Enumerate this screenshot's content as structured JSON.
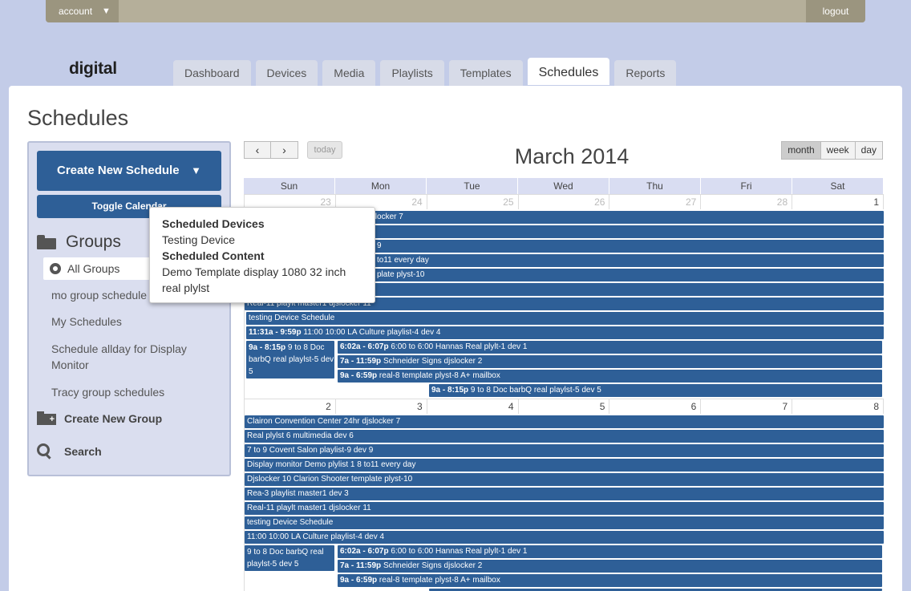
{
  "topbar": {
    "account_label": "account",
    "logout_label": "logout"
  },
  "logo": "digital",
  "tabs": [
    "Dashboard",
    "Devices",
    "Media",
    "Playlists",
    "Templates",
    "Schedules",
    "Reports"
  ],
  "page_title": "Schedules",
  "sidebar": {
    "create_schedule": "Create New Schedule",
    "toggle_calendar": "Toggle Calendar",
    "groups_title": "Groups",
    "all_groups": "All Groups",
    "items": [
      "mo group schedule",
      "My Schedules",
      "Schedule allday for Display Monitor",
      "Tracy group schedules"
    ],
    "create_group": "Create New Group",
    "search": "Search"
  },
  "calendar": {
    "title": "March 2014",
    "today": "today",
    "views": [
      "month",
      "week",
      "day"
    ],
    "days_of_week": [
      "Sun",
      "Mon",
      "Tue",
      "Wed",
      "Thu",
      "Fri",
      "Sat"
    ],
    "week1_days": [
      "23",
      "24",
      "25",
      "26",
      "27",
      "28",
      "1"
    ],
    "week2_days": [
      "2",
      "3",
      "4",
      "5",
      "6",
      "7",
      "8"
    ],
    "week1_events": [
      "djslocker 7",
      "",
      "9",
      "to11 every day",
      "plate plyst-10",
      "",
      "Real-11 playlt master1 djslocker 11",
      "testing Device Schedule"
    ],
    "week1_culture": {
      "time": "11:31a - 9:59p",
      "title": "11:00 10:00 LA Culture playlist-4 dev 4"
    },
    "week1_sun": {
      "time": "9a - 8:15p",
      "title": "9 to 8 Doc barbQ real playlst-5 dev 5"
    },
    "week1_mon": [
      {
        "time": "6:02a - 6:07p",
        "title": "6:00 to 6:00 Hannas Real plylt-1 dev 1"
      },
      {
        "time": "7a - 11:59p",
        "title": "Schneider Signs djslocker 2"
      },
      {
        "time": "9a - 6:59p",
        "title": "real-8 template plyst-8 A+ mailbox"
      }
    ],
    "week1_tue": {
      "time": "9a - 8:15p",
      "title": "9 to 8 Doc barbQ real playlst-5 dev 5"
    },
    "week2_events": [
      "Clairon Convention Center 24hr djslocker 7",
      "Real plylst 6 multimedia dev 6",
      "7 to 9 Covent Salon playlist-9 dev 9",
      "Display monitor Demo plylist 1 8 to11 every day",
      "Djslocker 10 Clarion Shooter template plyst-10",
      "Rea-3 playlist master1 dev 3",
      "Real-11 playlt master1 djslocker 11",
      "testing Device Schedule",
      "11:00 10:00 LA Culture playlist-4 dev 4"
    ],
    "week2_sun": "9 to 8 Doc barbQ real playlst-5 dev 5",
    "week2_mon": [
      {
        "time": "6:02a - 6:07p",
        "title": "6:00 to 6:00 Hannas Real plylt-1 dev 1"
      },
      {
        "time": "7a - 11:59p",
        "title": "Schneider Signs djslocker 2"
      },
      {
        "time": "9a - 6:59p",
        "title": "real-8 template plyst-8 A+ mailbox"
      }
    ]
  },
  "popup": {
    "devices_heading": "Scheduled Devices",
    "device": "Testing Device",
    "content_heading": "Scheduled Content",
    "content": "Demo Template display 1080 32 inch real plylst"
  },
  "colors": {
    "event": "#2e5f97",
    "background": "#c3cce8",
    "topbar": "#b5af9a"
  }
}
